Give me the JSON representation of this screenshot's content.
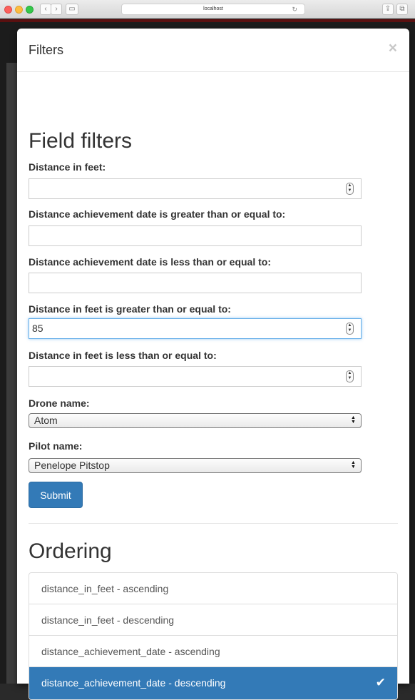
{
  "browser": {
    "address": "localhost"
  },
  "modal": {
    "title": "Filters",
    "close_label": "×"
  },
  "field_filters": {
    "heading": "Field filters",
    "fields": [
      {
        "label": "Distance in feet:",
        "value": "",
        "type": "number"
      },
      {
        "label": "Distance achievement date is greater than or equal to:",
        "value": "",
        "type": "text"
      },
      {
        "label": "Distance achievement date is less than or equal to:",
        "value": "",
        "type": "text"
      },
      {
        "label": "Distance in feet is greater than or equal to:",
        "value": "85",
        "type": "number"
      },
      {
        "label": "Distance in feet is less than or equal to:",
        "value": "",
        "type": "number"
      }
    ],
    "drone": {
      "label": "Drone name:",
      "selected": "Atom"
    },
    "pilot": {
      "label": "Pilot name:",
      "selected": "Penelope Pitstop"
    },
    "submit_label": "Submit"
  },
  "ordering": {
    "heading": "Ordering",
    "items": [
      {
        "label": "distance_in_feet - ascending",
        "active": false
      },
      {
        "label": "distance_in_feet - descending",
        "active": false
      },
      {
        "label": "distance_achievement_date - ascending",
        "active": false
      },
      {
        "label": "distance_achievement_date - descending",
        "active": true
      }
    ]
  },
  "colors": {
    "primary": "#337ab7",
    "focus": "#66afe9"
  }
}
